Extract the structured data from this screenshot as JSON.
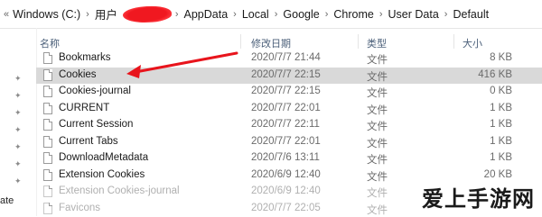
{
  "address": {
    "back_glyph": "«",
    "crumbs": [
      "Windows (C:)",
      "用户",
      "AppData",
      "Local",
      "Google",
      "Chrome",
      "User Data",
      "Default"
    ],
    "separator": "›"
  },
  "columns": {
    "name": "名称",
    "date": "修改日期",
    "type": "类型",
    "size": "大小"
  },
  "files": [
    {
      "name": "Bookmarks",
      "date": "2020/7/7 21:44",
      "type": "文件",
      "size": "8 KB"
    },
    {
      "name": "Cookies",
      "date": "2020/7/7 22:15",
      "type": "文件",
      "size": "416 KB"
    },
    {
      "name": "Cookies-journal",
      "date": "2020/7/7 22:15",
      "type": "文件",
      "size": "0 KB"
    },
    {
      "name": "CURRENT",
      "date": "2020/7/7 22:01",
      "type": "文件",
      "size": "1 KB"
    },
    {
      "name": "Current Session",
      "date": "2020/7/7 22:11",
      "type": "文件",
      "size": "1 KB"
    },
    {
      "name": "Current Tabs",
      "date": "2020/7/7 22:01",
      "type": "文件",
      "size": "1 KB"
    },
    {
      "name": "DownloadMetadata",
      "date": "2020/7/6 13:11",
      "type": "文件",
      "size": "1 KB"
    },
    {
      "name": "Extension Cookies",
      "date": "2020/6/9 12:40",
      "type": "文件",
      "size": "20 KB"
    },
    {
      "name": "Extension Cookies-journal",
      "date": "2020/6/9 12:40",
      "type": "文件",
      "size": ""
    },
    {
      "name": "Favicons",
      "date": "2020/7/7 22:05",
      "type": "文件",
      "size": ""
    }
  ],
  "selected_index": 1,
  "left_pane_text": "ate",
  "watermark": "爱上手游网",
  "icons": {
    "file": "file-icon",
    "pin": "pin-icon"
  },
  "colors": {
    "selection": "#d9d9d9",
    "arrow": "#e8141c",
    "header_text": "#4c607a"
  }
}
